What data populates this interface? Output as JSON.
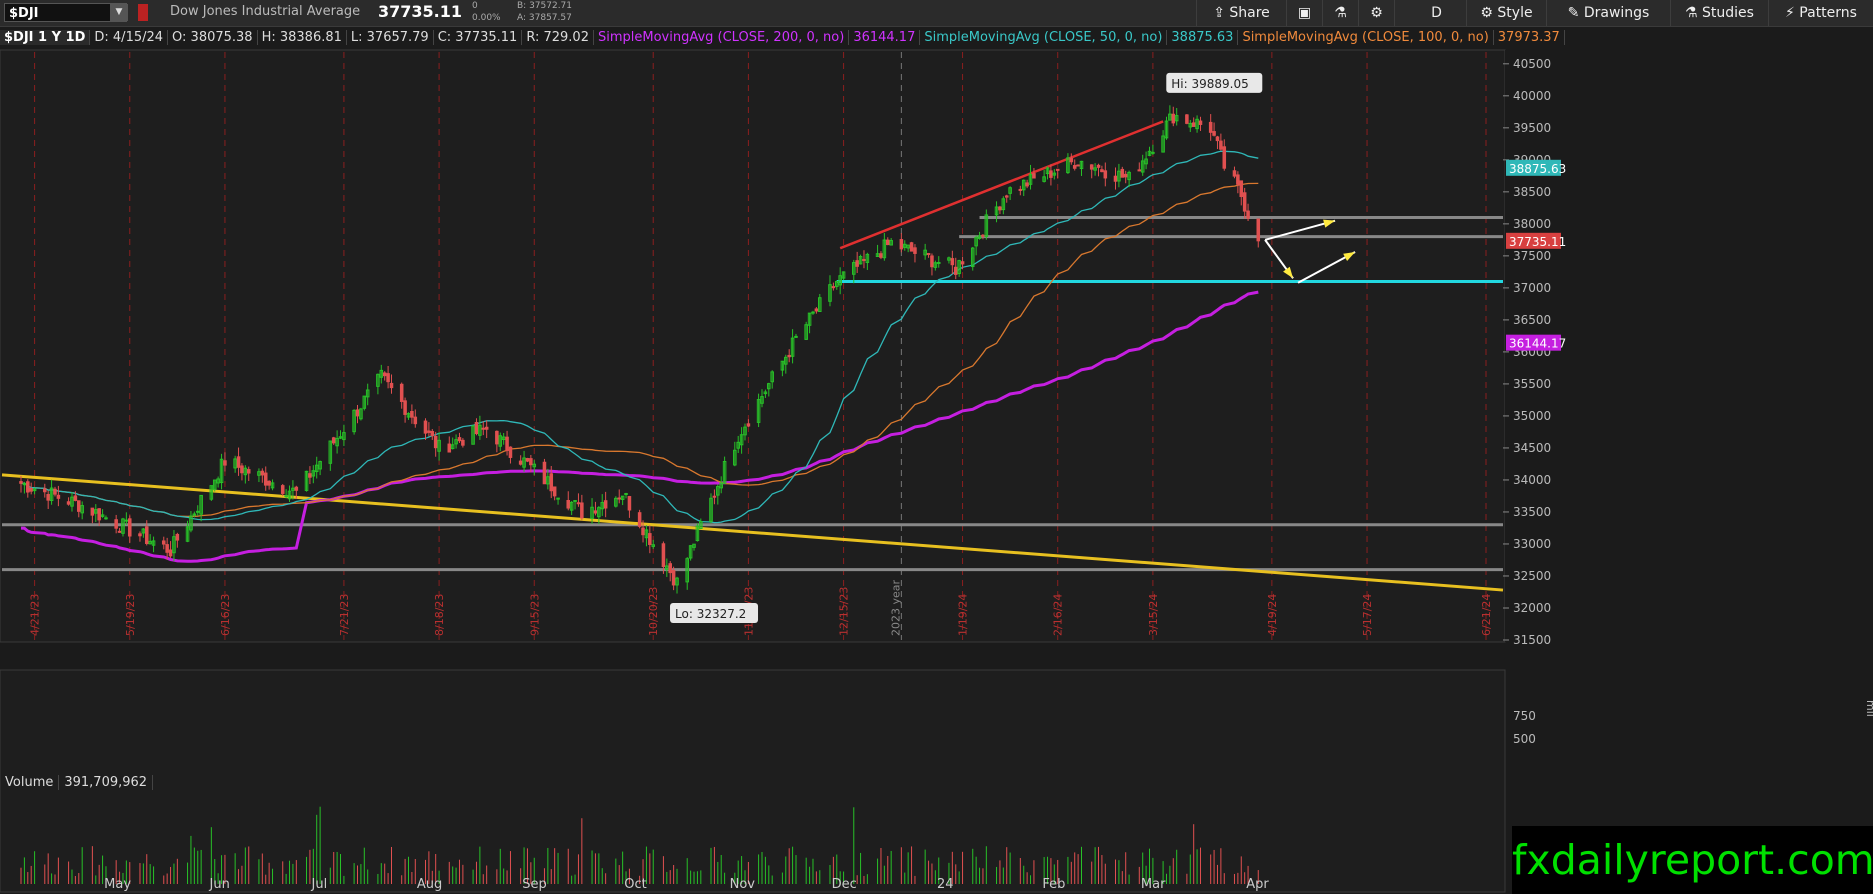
{
  "header": {
    "symbol": "$DJI",
    "name": "Dow Jones Industrial Average",
    "last": "37735.11",
    "change": "0",
    "change_pct": "0.00%",
    "bid": "B: 37572.71",
    "ask": "A: 37857.57",
    "buttons": {
      "share": "Share",
      "period": "D",
      "style": "Style",
      "drawings": "Drawings",
      "studies": "Studies",
      "patterns": "Patterns"
    }
  },
  "studybar": {
    "symbol_tf": "$DJI 1 Y 1D",
    "date": "D: 4/15/24",
    "open": "O: 38075.38",
    "high": "H: 38386.81",
    "low": "L: 37657.79",
    "close": "C: 37735.11",
    "range": "R: 729.02",
    "sma200_label": "SimpleMovingAvg (CLOSE, 200, 0, no)",
    "sma200_value": "36144.17",
    "sma50_label": "SimpleMovingAvg (CLOSE, 50, 0, no)",
    "sma50_value": "38875.63",
    "sma100_label": "SimpleMovingAvg (CLOSE, 100, 0, no)",
    "sma100_value": "37973.37"
  },
  "volume": {
    "label": "Volume",
    "value": "391,709,962",
    "axis_ticks": [
      "750",
      "500"
    ],
    "axis_unit": "mil"
  },
  "watermark": "fxdailyreport.com",
  "colors": {
    "up": "#28c028",
    "down": "#e05050",
    "sma50": "#2fb8b8",
    "sma100": "#d9782e",
    "sma200": "#c51fe0",
    "trendline": "#e8c020",
    "support": "#22d8e0",
    "resistance_trend": "#e03030",
    "level": "#888888"
  },
  "chart_data": {
    "type": "candlestick",
    "title": "Dow Jones Industrial Average",
    "ylim": [
      31500,
      40700
    ],
    "y_ticks": [
      40500,
      40000,
      39500,
      39000,
      38500,
      38000,
      37500,
      37000,
      36500,
      36000,
      35500,
      35000,
      34500,
      34000,
      33500,
      33000,
      32500,
      32000,
      31500
    ],
    "x_month_labels": [
      "May",
      "Jun",
      "Jul",
      "Aug",
      "Sep",
      "Oct",
      "Nov",
      "Dec",
      "24",
      "Feb",
      "Mar",
      "Apr"
    ],
    "x_date_markers": [
      "4/21/23",
      "5/19/23",
      "6/16/23",
      "7/21/23",
      "8/18/23",
      "9/15/23",
      "10/20/23",
      "11/17/23",
      "12/15/23",
      "1/19/24",
      "2/16/24",
      "3/15/24",
      "4/19/24",
      "5/17/24",
      "6/21/24"
    ],
    "year_marker": "2023 year",
    "annotations": {
      "high": "Hi: 39889.05",
      "low": "Lo: 32327.2"
    },
    "series_close_anchors": [
      {
        "date": "2023-04-17",
        "close": 33950
      },
      {
        "date": "2023-05-05",
        "close": 33600
      },
      {
        "date": "2023-05-31",
        "close": 32900
      },
      {
        "date": "2023-06-16",
        "close": 34300
      },
      {
        "date": "2023-07-07",
        "close": 33800
      },
      {
        "date": "2023-08-01",
        "close": 35600
      },
      {
        "date": "2023-08-18",
        "close": 34500
      },
      {
        "date": "2023-09-01",
        "close": 34800
      },
      {
        "date": "2023-09-29",
        "close": 33500
      },
      {
        "date": "2023-10-11",
        "close": 33800
      },
      {
        "date": "2023-10-27",
        "close": 32400
      },
      {
        "date": "2023-11-14",
        "close": 34700
      },
      {
        "date": "2023-12-01",
        "close": 36200
      },
      {
        "date": "2023-12-13",
        "close": 37100
      },
      {
        "date": "2023-12-29",
        "close": 37700
      },
      {
        "date": "2024-01-17",
        "close": 37300
      },
      {
        "date": "2024-02-01",
        "close": 38500
      },
      {
        "date": "2024-02-22",
        "close": 39000
      },
      {
        "date": "2024-03-08",
        "close": 38700
      },
      {
        "date": "2024-03-21",
        "close": 39700
      },
      {
        "date": "2024-04-01",
        "close": 39500
      },
      {
        "date": "2024-04-05",
        "close": 38900
      },
      {
        "date": "2024-04-10",
        "close": 38450
      },
      {
        "date": "2024-04-15",
        "close": 37735
      }
    ],
    "overlays": {
      "sma50_last": 38875.63,
      "sma100_last": 37973.37,
      "sma200_last": 36144.17,
      "horizontal_levels": [
        38100,
        37800,
        33300,
        32600
      ],
      "support_level": 37100
    }
  }
}
